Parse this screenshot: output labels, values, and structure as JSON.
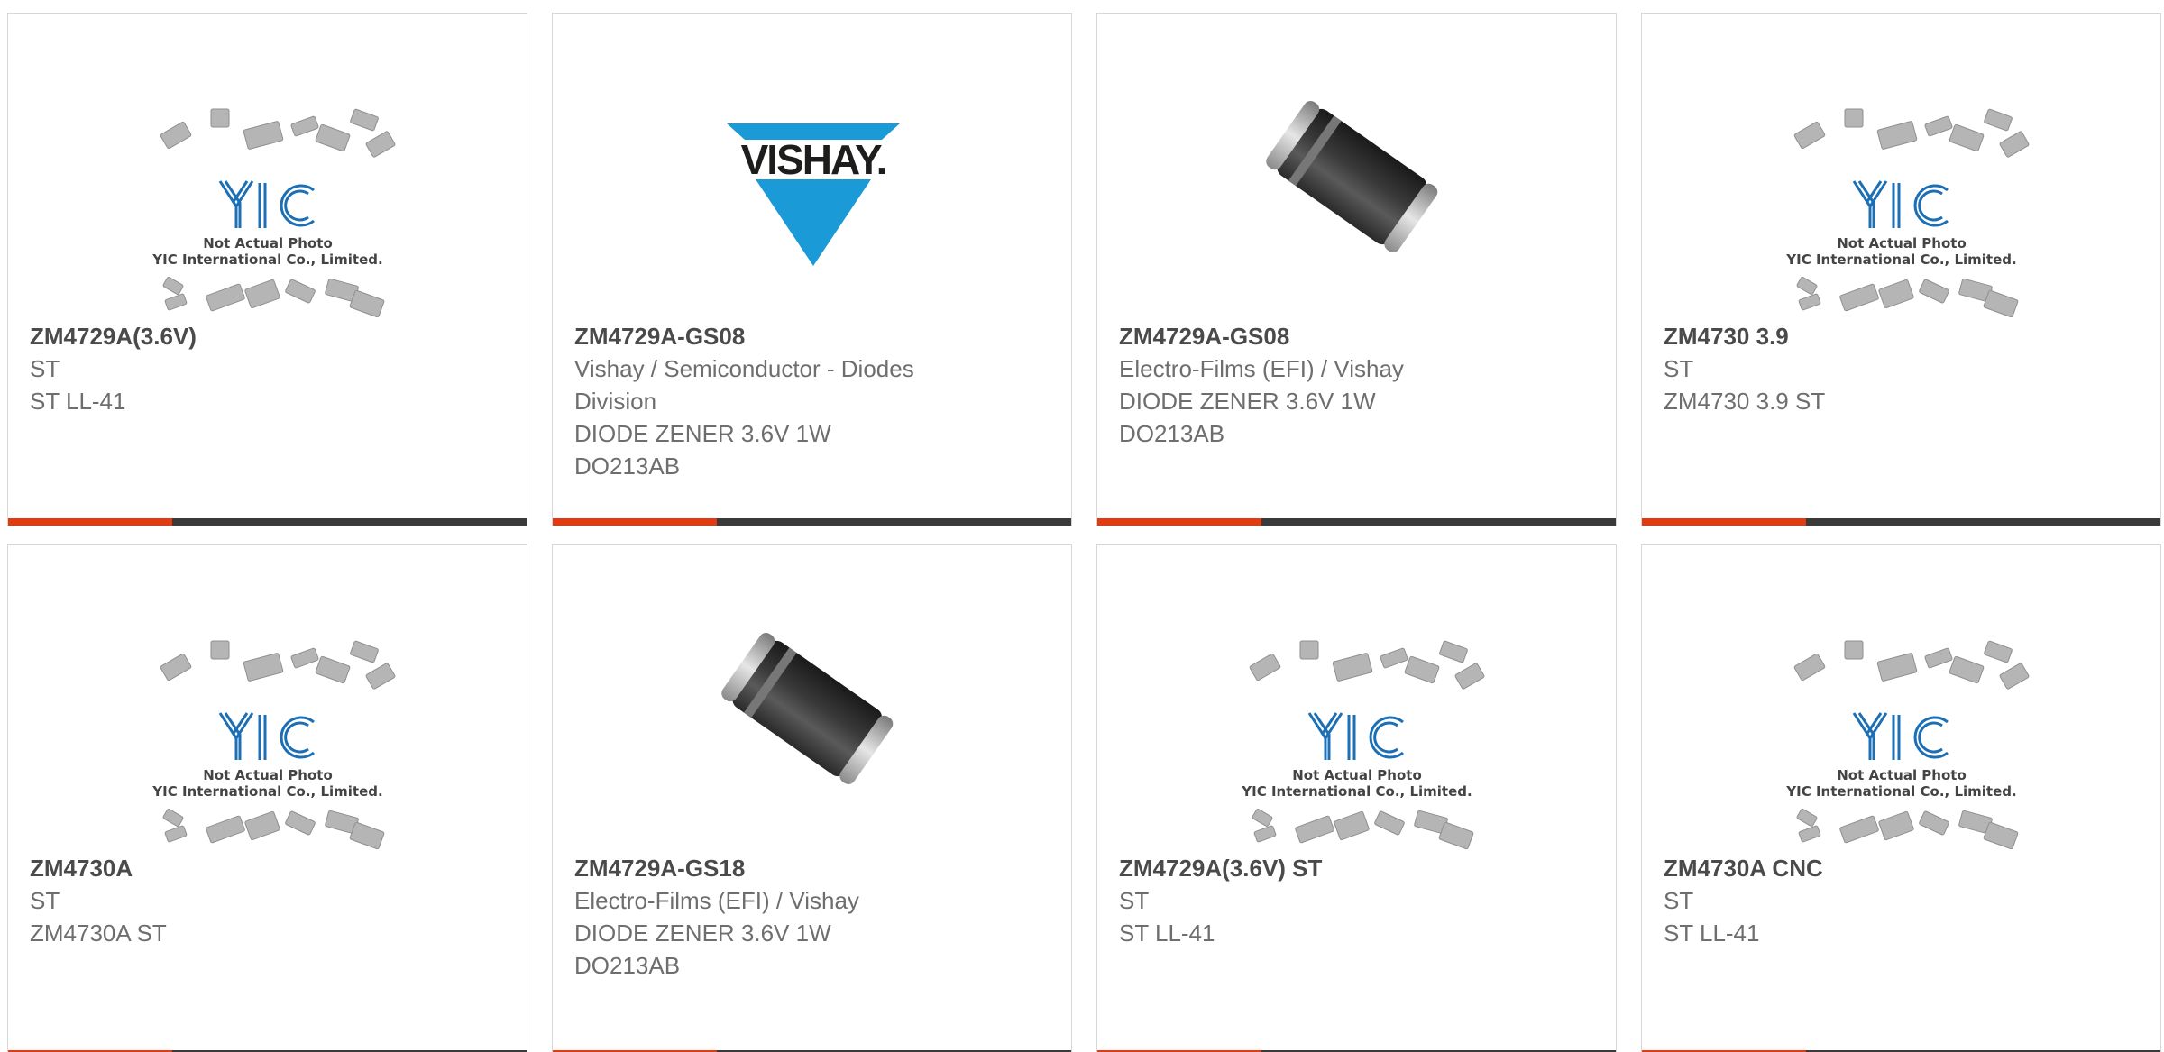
{
  "products": [
    {
      "image": "yic-placeholder",
      "image_caption": [
        "Not Actual Photo",
        "YIC International Co., Limited."
      ],
      "part_number": "ZM4729A(3.6V)",
      "lines": [
        "ST",
        "ST LL-41"
      ]
    },
    {
      "image": "vishay-logo",
      "image_caption": [
        "VISHAY."
      ],
      "part_number": "ZM4729A-GS08",
      "lines": [
        "Vishay / Semiconductor - Diodes",
        "Division",
        "DIODE ZENER 3.6V 1W",
        "DO213AB"
      ]
    },
    {
      "image": "diode-photo",
      "image_caption": [],
      "part_number": "ZM4729A-GS08",
      "lines": [
        "Electro-Films (EFI) / Vishay",
        "DIODE ZENER 3.6V 1W",
        "DO213AB"
      ]
    },
    {
      "image": "yic-placeholder",
      "image_caption": [
        "Not Actual Photo",
        "YIC International Co., Limited."
      ],
      "part_number": "ZM4730 3.9",
      "lines": [
        "ST",
        "ZM4730 3.9 ST"
      ]
    },
    {
      "image": "yic-placeholder",
      "image_caption": [
        "Not Actual Photo",
        "YIC International Co., Limited."
      ],
      "part_number": "ZM4730A",
      "lines": [
        "ST",
        "ZM4730A ST"
      ]
    },
    {
      "image": "diode-photo",
      "image_caption": [],
      "part_number": "ZM4729A-GS18",
      "lines": [
        "Electro-Films (EFI) / Vishay",
        "DIODE ZENER 3.6V 1W",
        "DO213AB"
      ]
    },
    {
      "image": "yic-placeholder",
      "image_caption": [
        "Not Actual Photo",
        "YIC International Co., Limited."
      ],
      "part_number": "ZM4729A(3.6V) ST",
      "lines": [
        "ST",
        "ST LL-41"
      ]
    },
    {
      "image": "yic-placeholder",
      "image_caption": [
        "Not Actual Photo",
        "YIC International Co., Limited."
      ],
      "part_number": "ZM4730A CNC",
      "lines": [
        "ST",
        "ST LL-41"
      ]
    }
  ],
  "colors": {
    "accent": "#e13b0f",
    "bar": "#3a3a3a",
    "vishay_blue": "#1a9ad6",
    "yic_blue": "#1c6fb5"
  }
}
